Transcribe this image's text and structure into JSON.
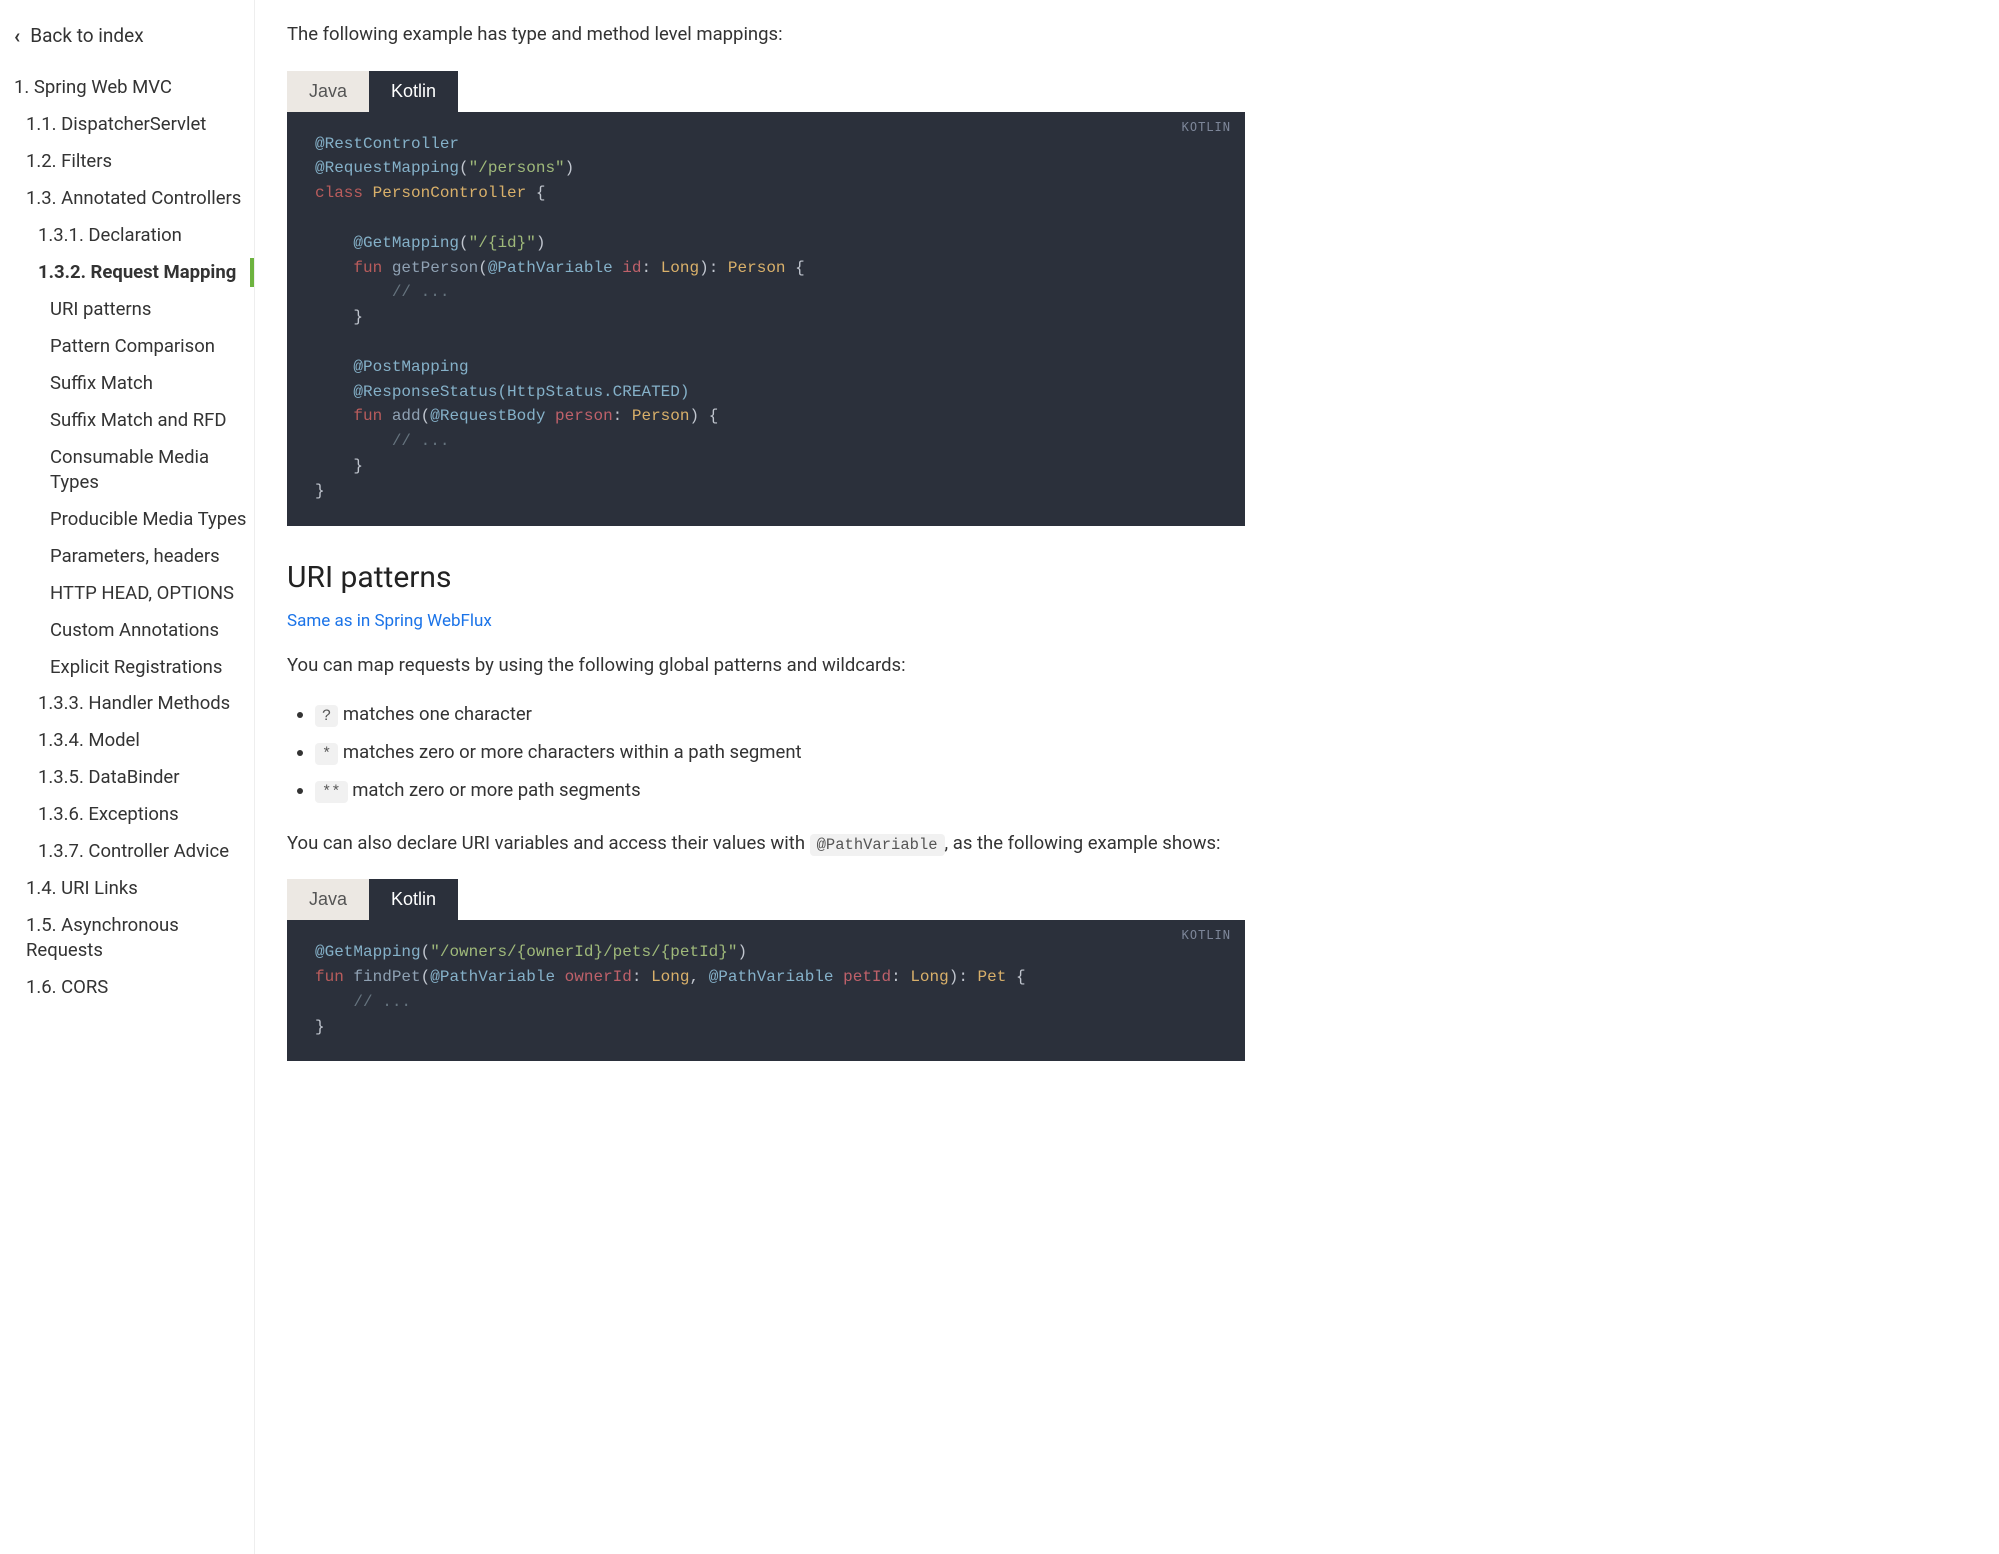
{
  "sidebar": {
    "back_label": "Back to index",
    "items": [
      {
        "label": "1. Spring Web MVC",
        "level": 1
      },
      {
        "label": "1.1. DispatcherServlet",
        "level": 2
      },
      {
        "label": "1.2. Filters",
        "level": 2
      },
      {
        "label": "1.3. Annotated Controllers",
        "level": 2
      },
      {
        "label": "1.3.1. Declaration",
        "level": 3
      },
      {
        "label": "1.3.2. Request Mapping",
        "level": 3,
        "active": true
      },
      {
        "label": "URI patterns",
        "level": 4
      },
      {
        "label": "Pattern Comparison",
        "level": 4
      },
      {
        "label": "Suffix Match",
        "level": 4
      },
      {
        "label": "Suffix Match and RFD",
        "level": 4
      },
      {
        "label": "Consumable Media Types",
        "level": 4
      },
      {
        "label": "Producible Media Types",
        "level": 4
      },
      {
        "label": "Parameters, headers",
        "level": 4
      },
      {
        "label": "HTTP HEAD, OPTIONS",
        "level": 4
      },
      {
        "label": "Custom Annotations",
        "level": 4
      },
      {
        "label": "Explicit Registrations",
        "level": 4
      },
      {
        "label": "1.3.3. Handler Methods",
        "level": 3
      },
      {
        "label": "1.3.4. Model",
        "level": 3
      },
      {
        "label": "1.3.5. DataBinder",
        "level": 3
      },
      {
        "label": "1.3.6. Exceptions",
        "level": 3
      },
      {
        "label": "1.3.7. Controller Advice",
        "level": 3
      },
      {
        "label": "1.4. URI Links",
        "level": 2
      },
      {
        "label": "1.5. Asynchronous Requests",
        "level": 2
      },
      {
        "label": "1.6. CORS",
        "level": 2
      }
    ]
  },
  "content": {
    "intro_para": "The following example has type and method level mappings:",
    "tabs": {
      "java": "Java",
      "kotlin": "Kotlin",
      "badge": "KOTLIN"
    },
    "section_uri_title": "URI patterns",
    "webflux_link": "Same as in Spring WebFlux",
    "patterns_intro": "You can map requests by using the following global patterns and wildcards:",
    "bullets": [
      {
        "code": "?",
        "text": " matches one character"
      },
      {
        "code": "*",
        "text": " matches zero or more characters within a path segment"
      },
      {
        "code": "**",
        "text": " match zero or more path segments"
      }
    ],
    "vars_para_pre": "You can also declare URI variables and access their values with ",
    "vars_para_code": "@PathVariable",
    "vars_para_post": ", as the following example shows:",
    "code1": {
      "l1a": "@RestController",
      "l2a": "@RequestMapping",
      "l2b": "(",
      "l2c": "\"/persons\"",
      "l2d": ")",
      "l3a": "class",
      "l3b": " PersonController ",
      "l3c": "{",
      "l5a": "@GetMapping",
      "l5b": "(",
      "l5c": "\"/{id}\"",
      "l5d": ")",
      "l6a": "fun",
      "l6b": " getPerson",
      "l6c": "(",
      "l6d": "@PathVariable",
      "l6e": " id",
      "l6f": ": ",
      "l6g": "Long",
      "l6h": "): ",
      "l6i": "Person ",
      "l6j": "{",
      "l7a": "// ...",
      "l8a": "}",
      "l10a": "@PostMapping",
      "l11a": "@ResponseStatus",
      "l11b": "(HttpStatus.CREATED)",
      "l12a": "fun",
      "l12b": " add",
      "l12c": "(",
      "l12d": "@RequestBody",
      "l12e": " person",
      "l12f": ": ",
      "l12g": "Person",
      "l12h": ") {",
      "l13a": "// ...",
      "l14a": "}",
      "l15a": "}"
    },
    "code2": {
      "l1a": "@GetMapping",
      "l1b": "(",
      "l1c": "\"/owners/{ownerId}/pets/{petId}\"",
      "l1d": ")",
      "l2a": "fun",
      "l2b": " findPet",
      "l2c": "(",
      "l2d": "@PathVariable",
      "l2e": " ownerId",
      "l2f": ": ",
      "l2g": "Long",
      "l2h": ", ",
      "l2i": "@PathVariable",
      "l2j": " petId",
      "l2k": ": ",
      "l2l": "Long",
      "l2m": "): ",
      "l2n": "Pet ",
      "l2o": "{",
      "l3a": "// ...",
      "l4a": "}"
    }
  }
}
